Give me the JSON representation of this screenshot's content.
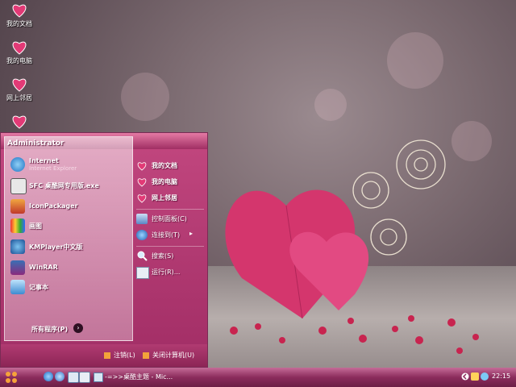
{
  "desktop": {
    "icons": [
      {
        "label": "我的文档",
        "icon": "heart-folder-icon"
      },
      {
        "label": "我的电脑",
        "icon": "heart-computer-icon"
      },
      {
        "label": "网上邻居",
        "icon": "heart-network-icon"
      },
      {
        "label": "",
        "icon": "heart-recycle-icon"
      }
    ]
  },
  "start_menu": {
    "user": "Administrator",
    "left_items": [
      {
        "title": "Internet",
        "subtitle": "Internet Explorer",
        "icon": "ie-icon"
      },
      {
        "title": "SFC 桌酷网专用版.exe",
        "subtitle": "",
        "icon": "sfc-icon"
      },
      {
        "title": "IconPackager",
        "subtitle": "",
        "icon": "iconpackager-icon"
      },
      {
        "title": "画图",
        "subtitle": "",
        "icon": "paint-icon"
      },
      {
        "title": "KMPlayer中文版",
        "subtitle": "",
        "icon": "kmplayer-icon"
      },
      {
        "title": "WinRAR",
        "subtitle": "",
        "icon": "winrar-icon"
      },
      {
        "title": "记事本",
        "subtitle": "",
        "icon": "notepad-icon"
      }
    ],
    "all_programs": "所有程序(P)",
    "right_items": [
      {
        "label": "我的文档",
        "icon": "my-documents-icon",
        "bold": true
      },
      {
        "label": "我的电脑",
        "icon": "my-computer-icon",
        "bold": true
      },
      {
        "label": "网上邻居",
        "icon": "network-places-icon",
        "bold": true
      },
      {
        "label": "控制面板(C)",
        "icon": "control-panel-icon",
        "bold": false
      },
      {
        "label": "连接到(T)",
        "icon": "connect-to-icon",
        "bold": false
      },
      {
        "label": "搜索(S)",
        "icon": "search-icon",
        "bold": false
      },
      {
        "label": "运行(R)...",
        "icon": "run-icon",
        "bold": false
      }
    ],
    "logoff": "注销(L)",
    "shutdown": "关闭计算机(U)"
  },
  "taskbar": {
    "task_title": "-=>>桌酷主题 - Mic...",
    "clock": "22:15"
  },
  "colors": {
    "accent": "#a12d65",
    "taskbar": "#8b2c5c",
    "heart": "#e23a76"
  }
}
